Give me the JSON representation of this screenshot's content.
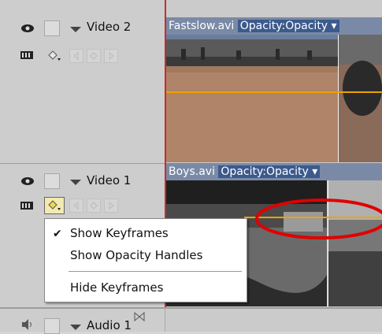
{
  "tracks": {
    "video2": {
      "name": "Video 2"
    },
    "video1": {
      "name": "Video 1"
    },
    "audio1": {
      "name": "Audio 1"
    }
  },
  "clips": {
    "v2": {
      "name": "Fastslow.avi",
      "opacity_label": "Opacity:Opacity"
    },
    "v1": {
      "name": "Boys.avi",
      "opacity_label": "Opacity:Opacity"
    }
  },
  "menu": {
    "items": [
      {
        "label": "Show Keyframes",
        "checked": true
      },
      {
        "label": "Show Opacity Handles",
        "checked": false
      },
      {
        "label": "Hide Keyframes",
        "checked": false
      }
    ]
  },
  "colors": {
    "opacity_line": "#f0a000",
    "playhead": "#cc2a2a",
    "highlight_ellipse": "#e00000",
    "clip_label_bg": "#3c5a8c"
  }
}
